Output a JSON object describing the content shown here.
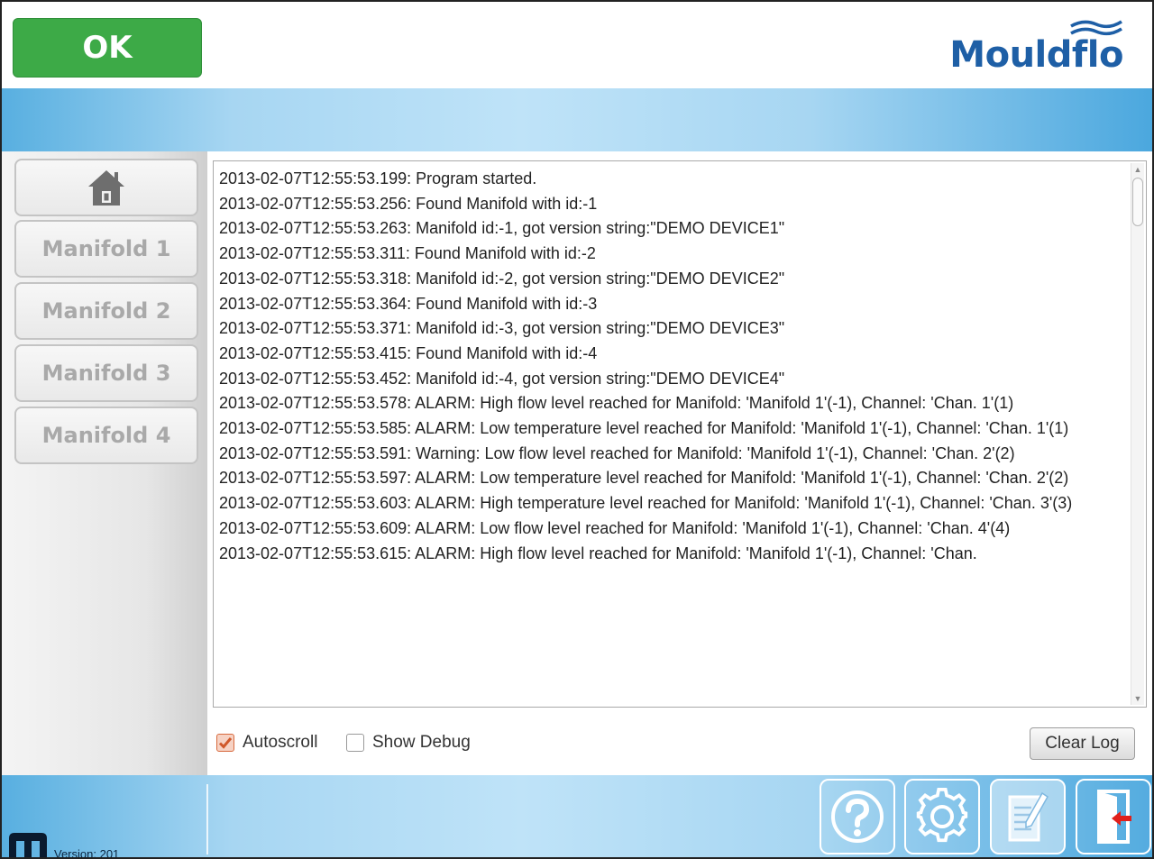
{
  "header": {
    "ok_label": "OK",
    "logo_text": "Mouldflo"
  },
  "sidebar": {
    "items": [
      {
        "label": "",
        "icon": "home-icon"
      },
      {
        "label": "Manifold 1"
      },
      {
        "label": "Manifold 2"
      },
      {
        "label": "Manifold 3"
      },
      {
        "label": "Manifold 4"
      }
    ]
  },
  "log": {
    "lines": [
      "2013-02-07T12:55:53.199: Program started.",
      "2013-02-07T12:55:53.256: Found Manifold with id:-1",
      "2013-02-07T12:55:53.263: Manifold id:-1, got version string:\"DEMO DEVICE1\"",
      "2013-02-07T12:55:53.311: Found Manifold with id:-2",
      "2013-02-07T12:55:53.318: Manifold id:-2, got version string:\"DEMO DEVICE2\"",
      "2013-02-07T12:55:53.364: Found Manifold with id:-3",
      "2013-02-07T12:55:53.371: Manifold id:-3, got version string:\"DEMO DEVICE3\"",
      "2013-02-07T12:55:53.415: Found Manifold with id:-4",
      "2013-02-07T12:55:53.452: Manifold id:-4, got version string:\"DEMO DEVICE4\"",
      "2013-02-07T12:55:53.578: ALARM: High flow level reached for Manifold: 'Manifold 1'(-1), Channel: 'Chan. 1'(1)",
      "2013-02-07T12:55:53.585: ALARM: Low temperature level reached for Manifold: 'Manifold 1'(-1), Channel: 'Chan. 1'(1)",
      "2013-02-07T12:55:53.591: Warning: Low flow level reached for Manifold: 'Manifold 1'(-1), Channel: 'Chan. 2'(2)",
      "2013-02-07T12:55:53.597: ALARM: Low temperature level reached for Manifold: 'Manifold 1'(-1), Channel: 'Chan. 2'(2)",
      "2013-02-07T12:55:53.603: ALARM: High temperature level reached for Manifold: 'Manifold 1'(-1), Channel: 'Chan. 3'(3)",
      "2013-02-07T12:55:53.609: ALARM: Low flow level reached for Manifold: 'Manifold 1'(-1), Channel: 'Chan. 4'(4)",
      "2013-02-07T12:55:53.615: ALARM: High flow level reached for Manifold: 'Manifold 1'(-1), Channel: 'Chan."
    ]
  },
  "controls": {
    "autoscroll_label": "Autoscroll",
    "autoscroll_checked": true,
    "show_debug_label": "Show Debug",
    "show_debug_checked": false,
    "clear_log_label": "Clear Log"
  },
  "footer": {
    "version": "Version: 201",
    "buttons": [
      {
        "icon": "help-icon"
      },
      {
        "icon": "gear-icon"
      },
      {
        "icon": "log-icon",
        "active": true
      },
      {
        "icon": "exit-icon"
      }
    ]
  },
  "colors": {
    "ok_green": "#3daa47",
    "brand_blue": "#1e5fa6",
    "band_blue": "#58afe0",
    "checkbox_accent": "#d86a3e"
  }
}
